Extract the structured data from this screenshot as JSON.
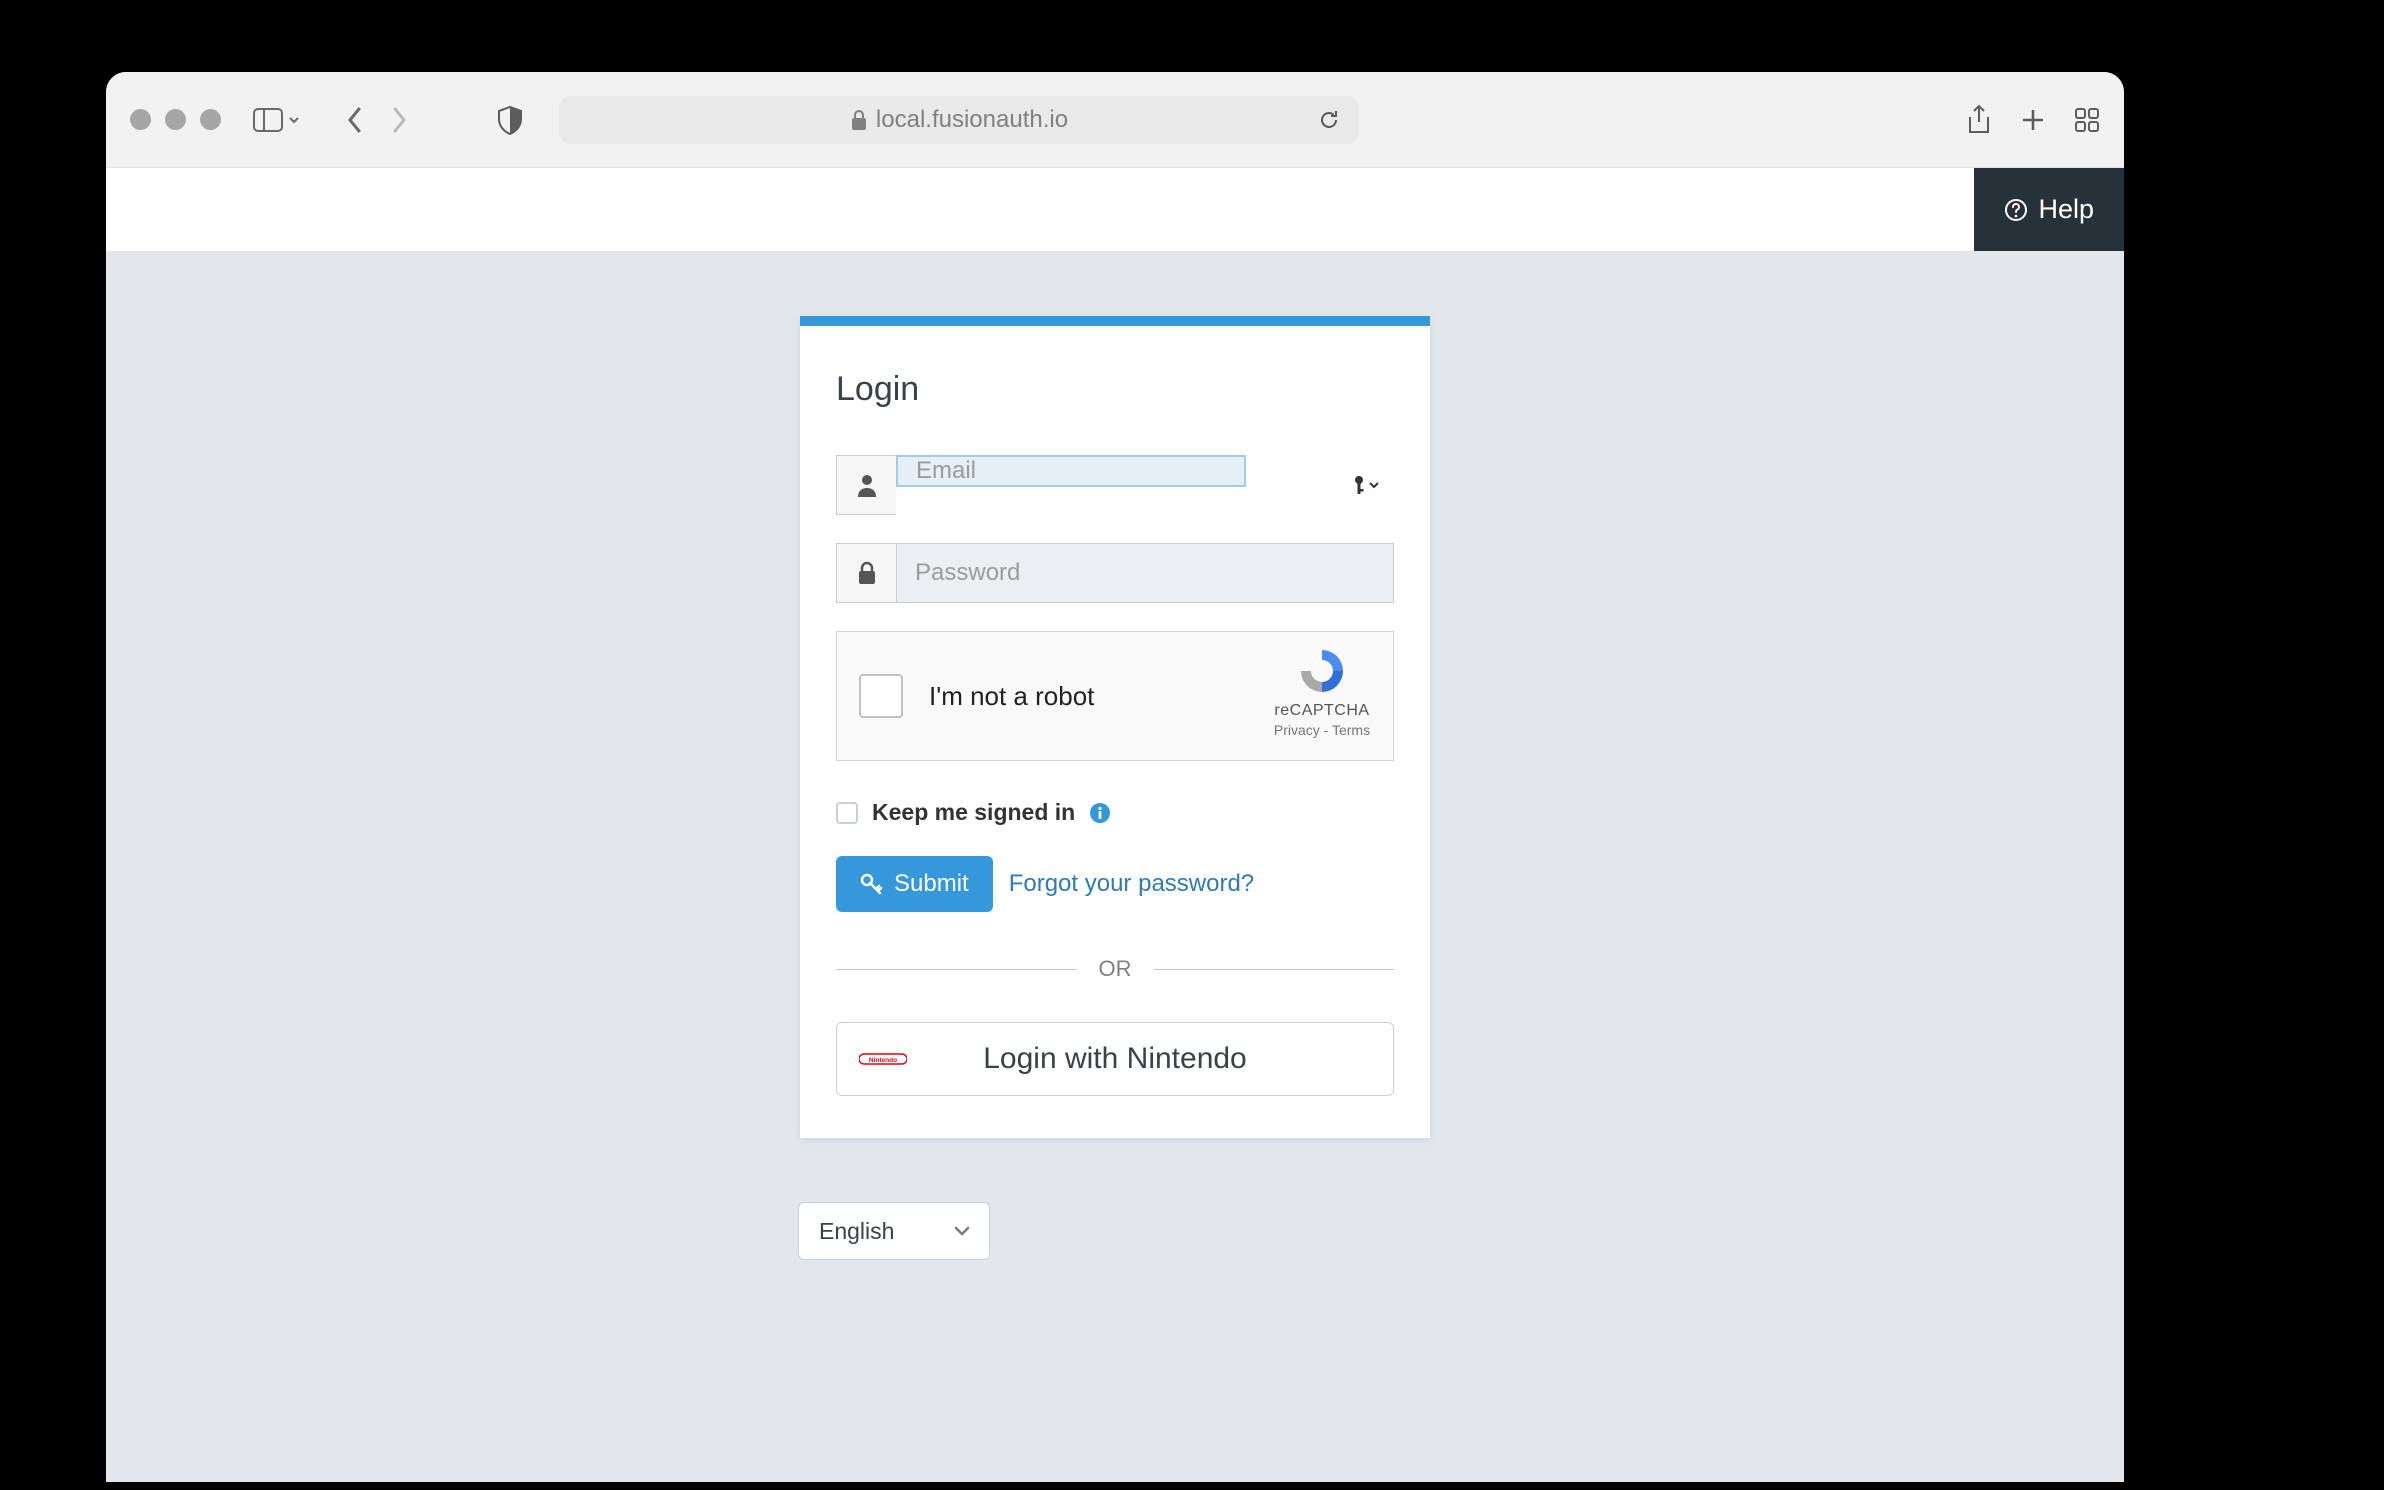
{
  "browser": {
    "url": "local.fusionauth.io"
  },
  "header": {
    "help_label": "Help"
  },
  "login": {
    "title": "Login",
    "email_placeholder": "Email",
    "password_placeholder": "Password",
    "captcha_label": "I'm not a robot",
    "captcha_brand": "reCAPTCHA",
    "captcha_privacy": "Privacy",
    "captcha_terms": "Terms",
    "keep_signed_in": "Keep me signed in",
    "submit_label": "Submit",
    "forgot_label": "Forgot your password?",
    "divider_label": "OR",
    "idp_label": "Login with Nintendo"
  },
  "locale": {
    "selected": "English"
  }
}
